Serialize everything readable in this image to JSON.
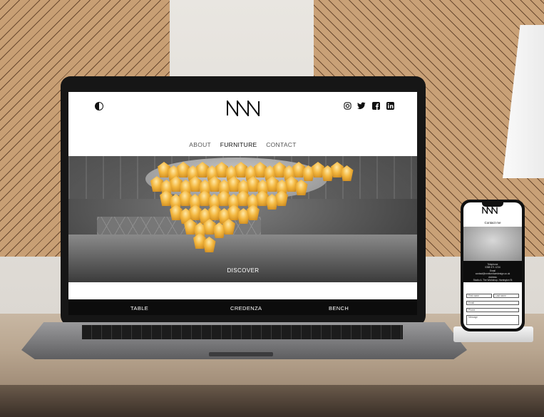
{
  "website": {
    "nav": [
      "ABOUT",
      "FURNITURE",
      "CONTACT"
    ],
    "active_nav": "FURNITURE",
    "hero_cta": "DISCOVER",
    "categories": [
      "TABLE",
      "CREDENZA",
      "BENCH"
    ],
    "social_icons": [
      "instagram-icon",
      "twitter-icon",
      "facebook-icon",
      "linkedin-icon"
    ]
  },
  "phone": {
    "title": "Contact me",
    "info_lines": [
      "Telephone",
      "0388 371 1234",
      "Email",
      "contact@nnnfurnituredesign.co.uk",
      "Address",
      "Studio A, The Workshop, Harrington St",
      "Wandsworth Town, SW18 1XY"
    ],
    "fields": [
      "First name",
      "Last name",
      "Email",
      "Phone",
      "Message"
    ]
  },
  "colors": {
    "accent_gold": "#f3b73f",
    "screen_bg": "#ffffff",
    "dark": "#0c0c0c"
  }
}
